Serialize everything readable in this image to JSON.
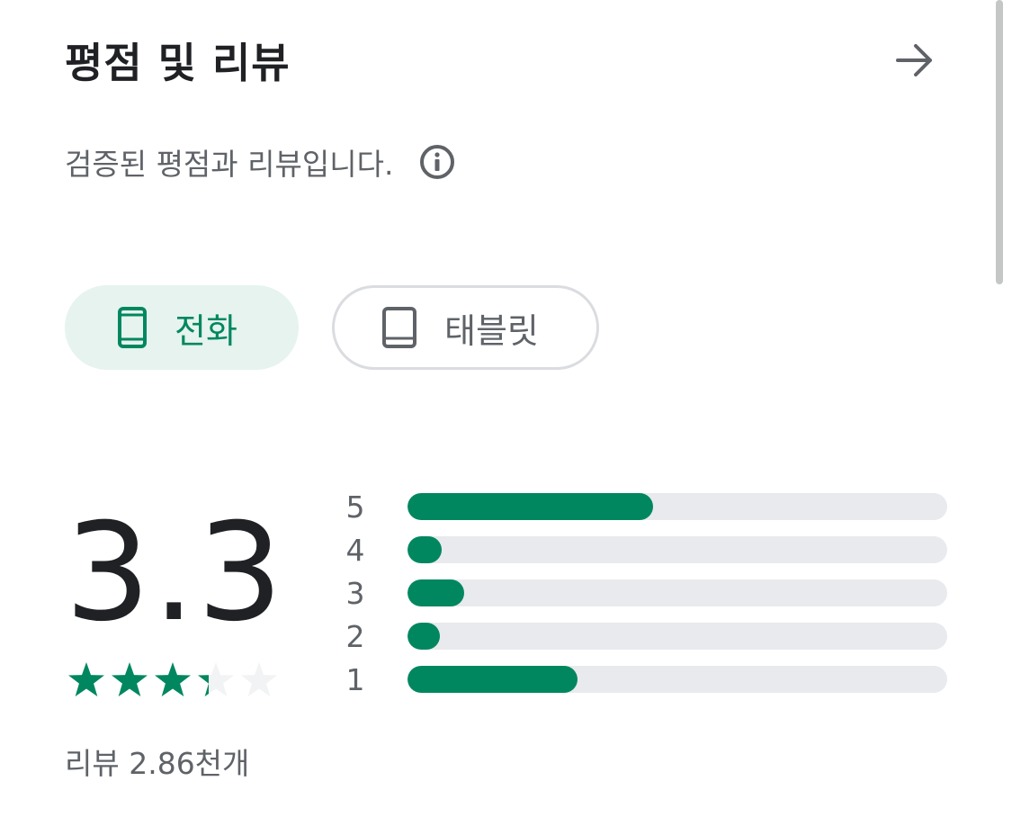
{
  "header": {
    "title": "평점 및 리뷰"
  },
  "subtitle": "검증된 평점과 리뷰입니다.",
  "chips": [
    {
      "label": "전화",
      "icon": "phone-icon",
      "selected": true
    },
    {
      "label": "태블릿",
      "icon": "tablet-icon",
      "selected": false
    }
  ],
  "rating": {
    "value": "3.3",
    "stars": 3.3,
    "review_count": "리뷰 2.86천개"
  },
  "distribution": [
    {
      "star": "5",
      "fraction": 0.455
    },
    {
      "star": "4",
      "fraction": 0.063
    },
    {
      "star": "3",
      "fraction": 0.105
    },
    {
      "star": "2",
      "fraction": 0.06
    },
    {
      "star": "1",
      "fraction": 0.315
    }
  ],
  "colors": {
    "accent": "#01875f",
    "chip_bg": "#e6f3ee",
    "track": "#e8eaed",
    "text_secondary": "#5f6368"
  }
}
